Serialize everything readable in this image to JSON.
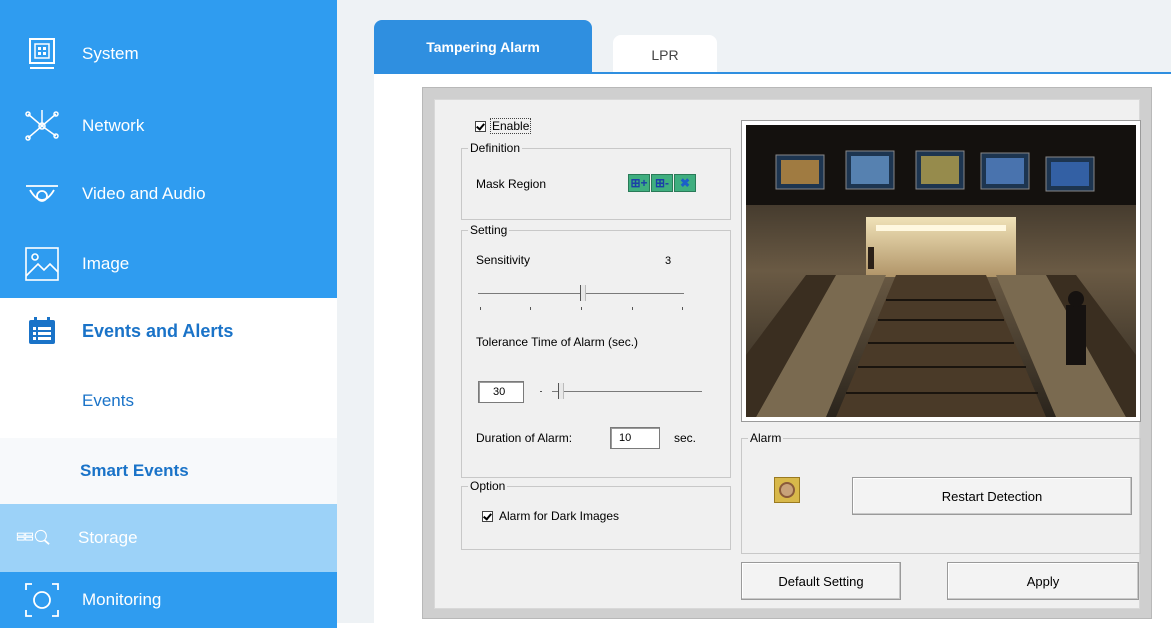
{
  "sidebar": {
    "items": [
      {
        "label": "System",
        "icon": "system-icon"
      },
      {
        "label": "Network",
        "icon": "network-icon"
      },
      {
        "label": "Video and Audio",
        "icon": "camera-icon"
      },
      {
        "label": "Image",
        "icon": "image-icon"
      },
      {
        "label": "Events and Alerts",
        "icon": "calendar-icon"
      },
      {
        "label": "Events"
      },
      {
        "label": "Smart Events"
      },
      {
        "label": "Storage",
        "icon": "storage-icon"
      },
      {
        "label": "Monitoring",
        "icon": "monitoring-icon"
      }
    ]
  },
  "tabs": [
    {
      "label": "Tampering Alarm",
      "active": true
    },
    {
      "label": "LPR",
      "active": false
    }
  ],
  "dialog": {
    "enable_label": "Enable",
    "enable_checked": true,
    "definition": {
      "title": "Definition",
      "mask_region_label": "Mask Region",
      "buttons": [
        "mask-add-icon",
        "mask-remove-icon",
        "mask-clear-icon"
      ]
    },
    "setting": {
      "title": "Setting",
      "sensitivity_label": "Sensitivity",
      "sensitivity_value": "3",
      "sensitivity_level": 3,
      "sensitivity_max": 5,
      "tolerance_label": "Tolerance Time of Alarm (sec.)",
      "tolerance_value": "30",
      "duration_label": "Duration of Alarm:",
      "duration_value": "10",
      "duration_unit": "sec."
    },
    "option": {
      "title": "Option",
      "dark_images_label": "Alarm for Dark Images",
      "dark_images_checked": true
    },
    "alarm": {
      "title": "Alarm",
      "indicator_icon": "alarm-indicator-icon",
      "restart_label": "Restart Detection"
    },
    "default_label": "Default Setting",
    "apply_label": "Apply"
  },
  "colors": {
    "sidebar": "#2f9cf0",
    "sidebar_highlight": "#9cd2f8",
    "tab_active": "#2f8fe0",
    "accent_text": "#1a73c8"
  }
}
